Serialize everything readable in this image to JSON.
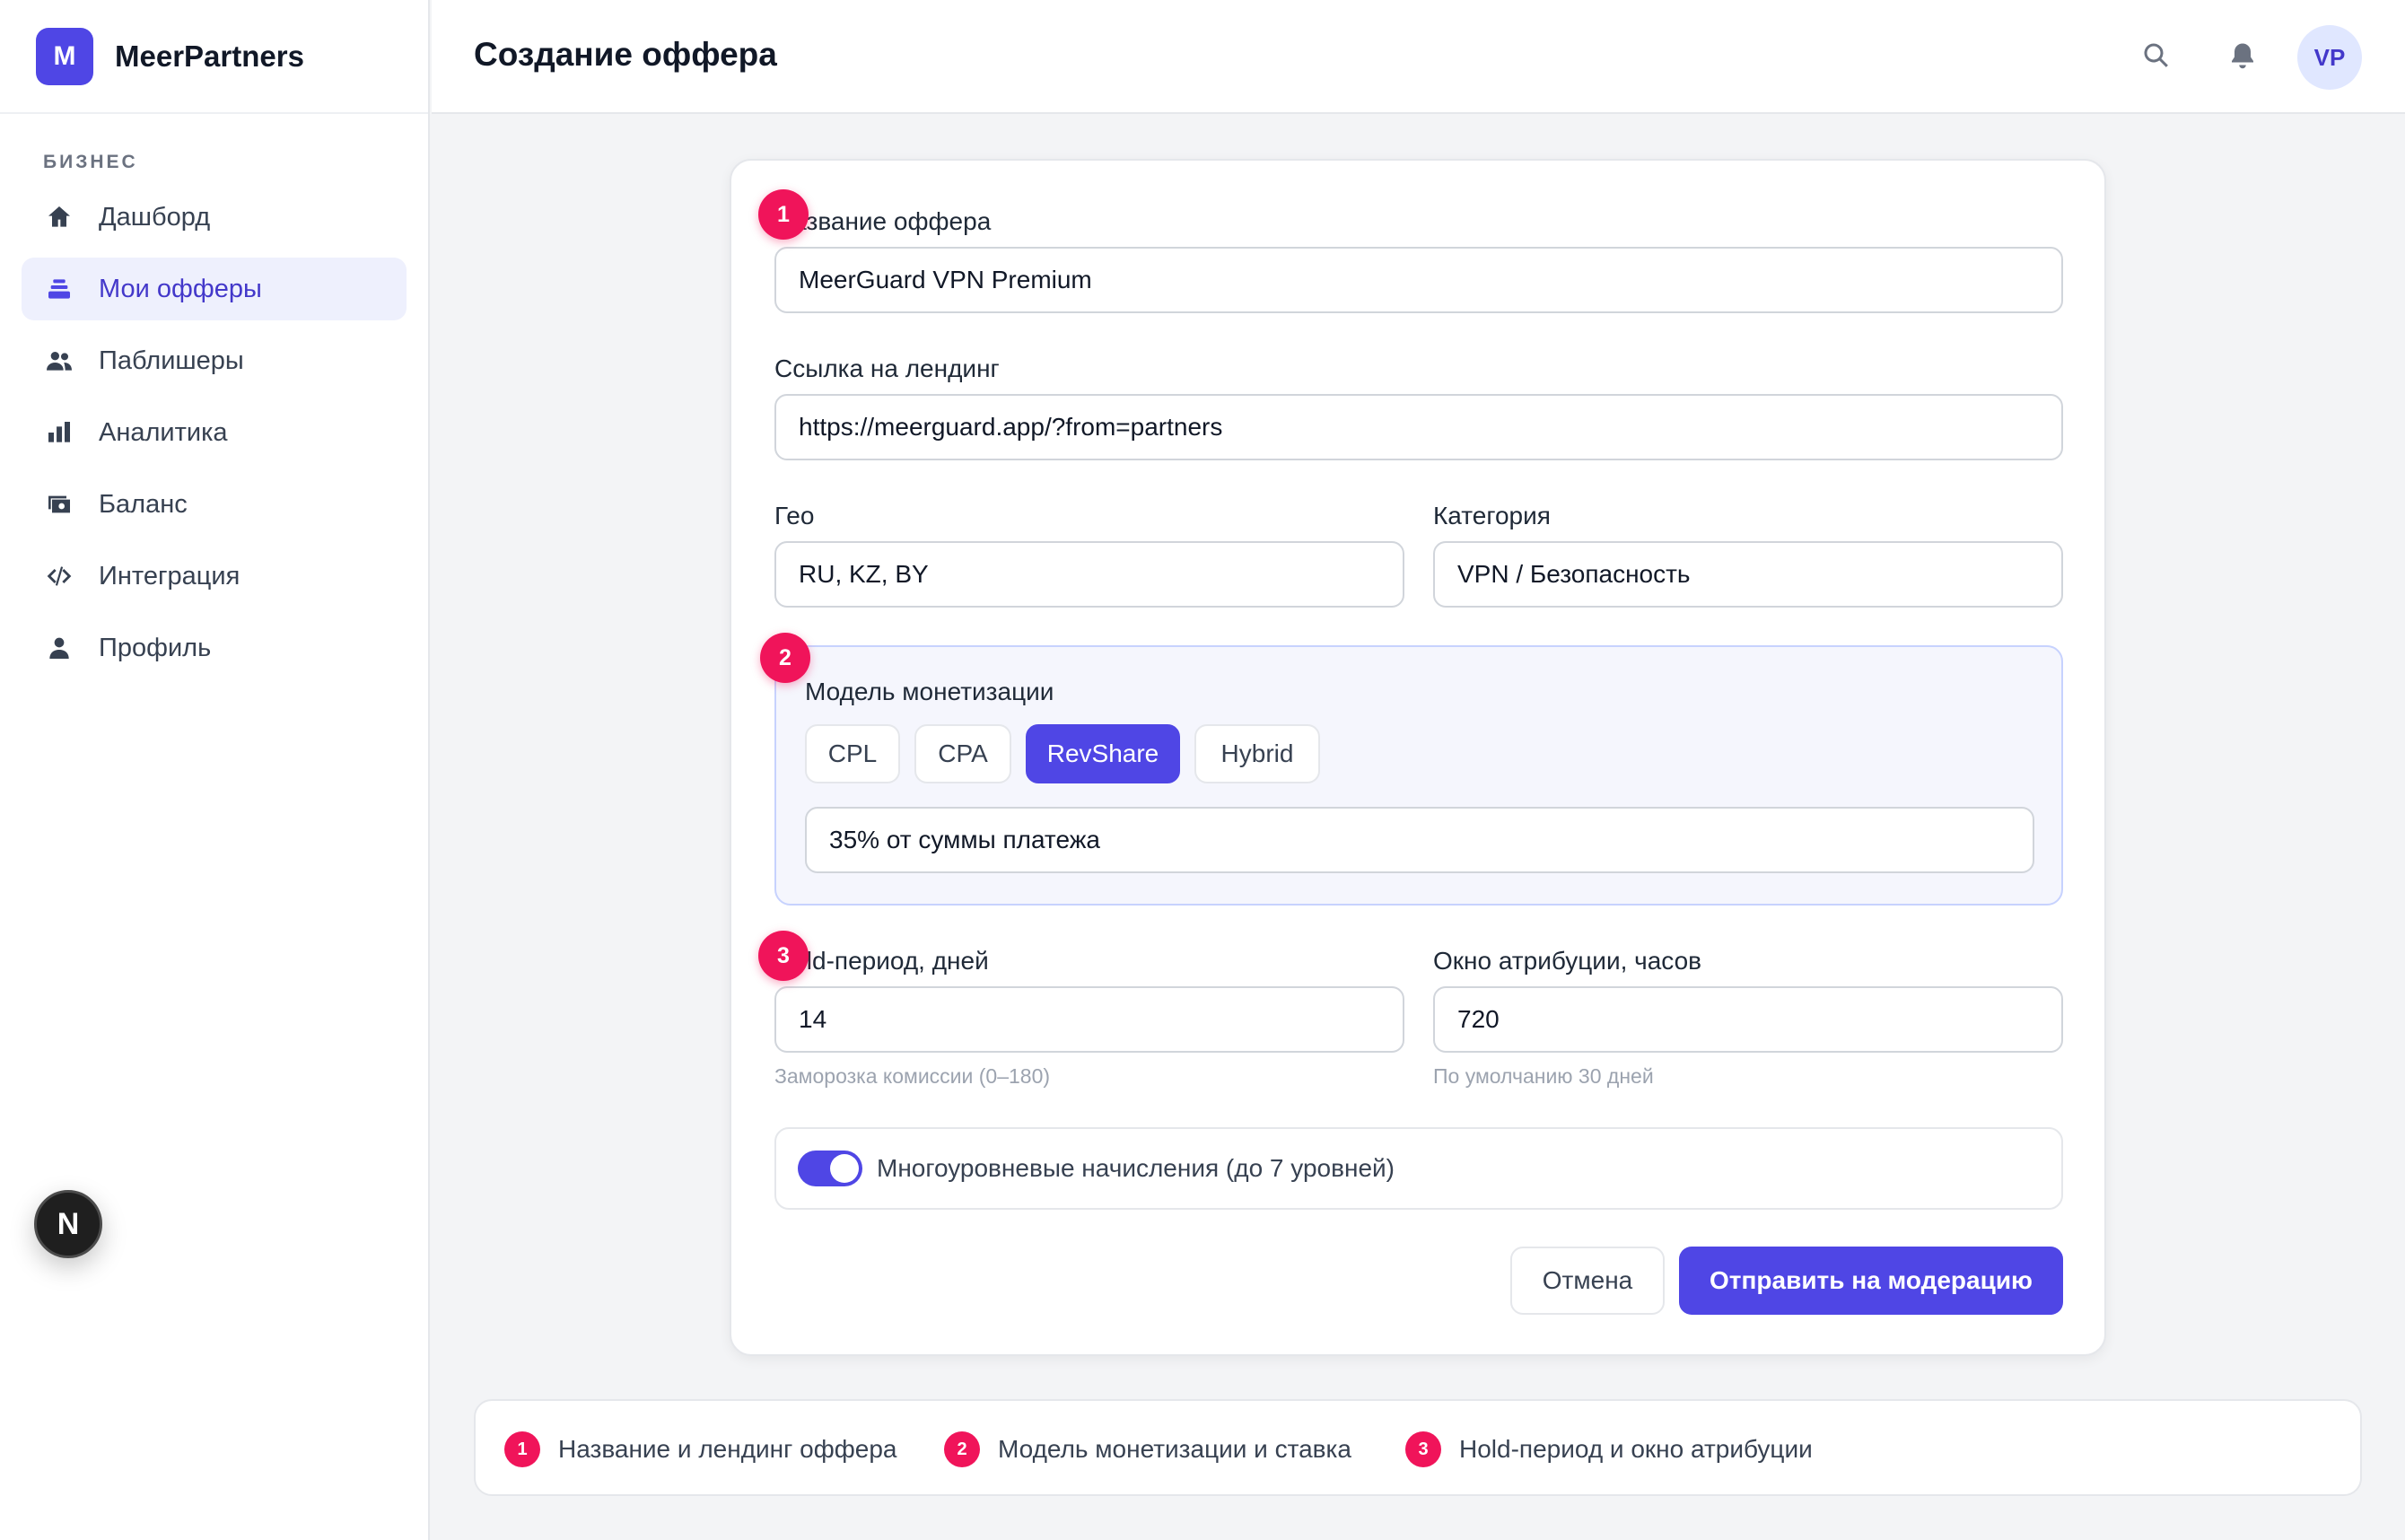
{
  "brand": {
    "logo_letter": "M",
    "name": "MeerPartners"
  },
  "sidebar": {
    "section": "БИЗНЕС",
    "items": [
      {
        "label": "Дашборд",
        "icon": "home-icon",
        "active": false
      },
      {
        "label": "Мои офферы",
        "icon": "stack-icon",
        "active": true
      },
      {
        "label": "Паблишеры",
        "icon": "users-icon",
        "active": false
      },
      {
        "label": "Аналитика",
        "icon": "bar-chart-icon",
        "active": false
      },
      {
        "label": "Баланс",
        "icon": "wallet-icon",
        "active": false
      },
      {
        "label": "Интеграция",
        "icon": "code-icon",
        "active": false
      },
      {
        "label": "Профиль",
        "icon": "person-icon",
        "active": false
      }
    ]
  },
  "next_badge": "N",
  "header": {
    "title": "Создание оффера",
    "avatar": "VP"
  },
  "form": {
    "offer_name": {
      "label": "Название оффера",
      "value": "MeerGuard VPN Premium"
    },
    "landing": {
      "label": "Ссылка на лендинг",
      "value": "https://meerguard.app/?from=partners"
    },
    "geo": {
      "label": "Гео",
      "value": "RU, KZ, BY"
    },
    "category": {
      "label": "Категория",
      "value": "VPN / Безопасность"
    },
    "monetization": {
      "label": "Модель монетизации",
      "options": [
        "CPL",
        "CPA",
        "RevShare",
        "Hybrid"
      ],
      "selected": "RevShare",
      "rate": "35% от суммы платежа"
    },
    "hold": {
      "label": "Hold-период, дней",
      "value": "14",
      "hint": "Заморозка комиссии (0–180)"
    },
    "attribution": {
      "label": "Окно атрибуции, часов",
      "value": "720",
      "hint": "По умолчанию 30 дней"
    },
    "multilevel": {
      "label": "Многоуровневые начисления (до 7 уровней)",
      "enabled": true
    },
    "cancel": "Отмена",
    "submit": "Отправить на модерацию"
  },
  "markers": [
    "1",
    "2",
    "3"
  ],
  "legend": [
    {
      "num": "1",
      "text": "Название и лендинг оффера"
    },
    {
      "num": "2",
      "text": "Модель монетизации и ставка"
    },
    {
      "num": "3",
      "text": "Hold-период и окно атрибуции"
    }
  ],
  "colors": {
    "accent": "#4f46e5",
    "marker": "#f0145a"
  }
}
